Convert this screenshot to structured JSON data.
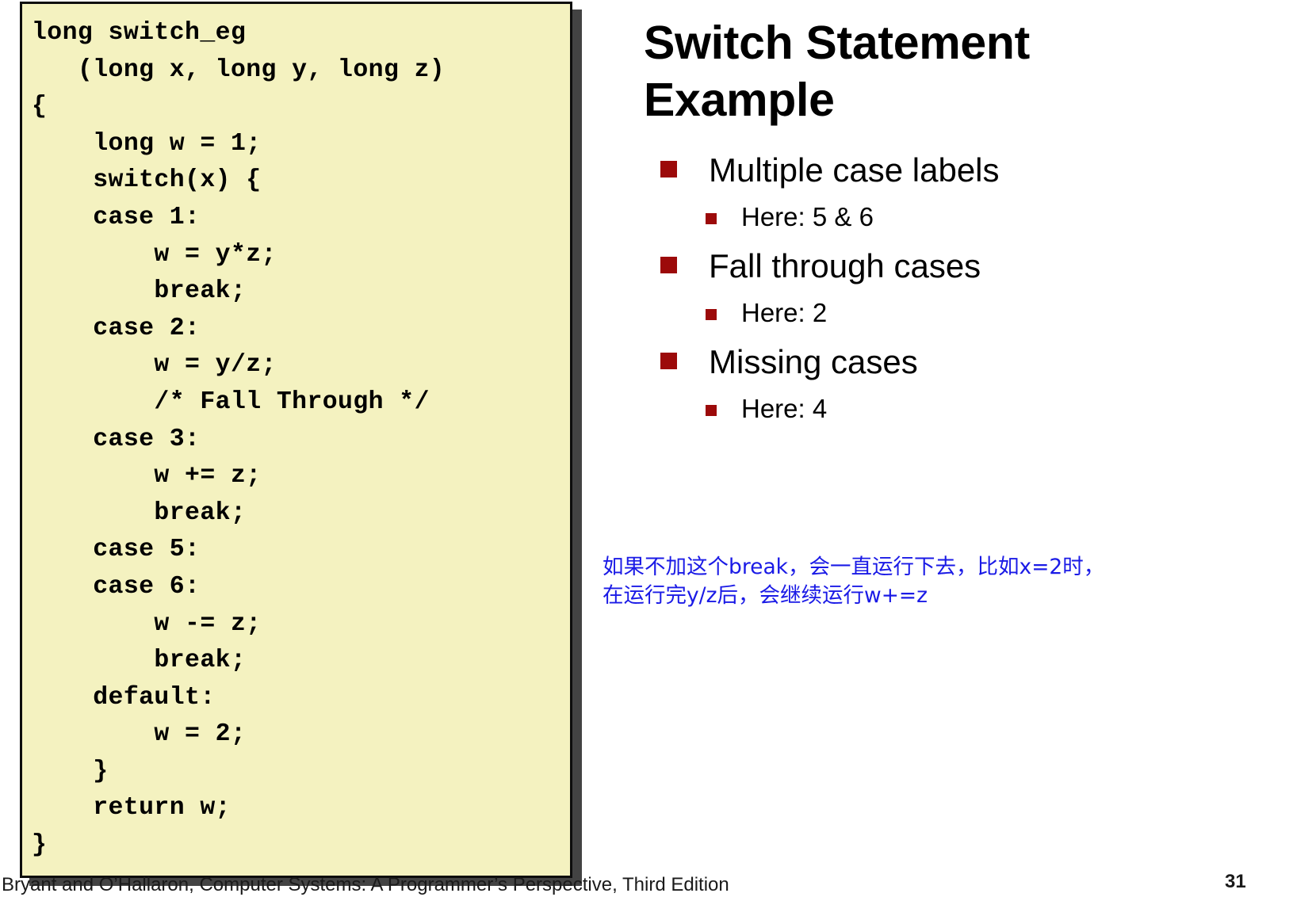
{
  "slide": {
    "title": "Switch Statement Example",
    "page_number": "31",
    "footer": "Bryant and O’Hallaron, Computer Systems: A Programmer’s Perspective, Third Edition",
    "accent_color": "#9c0a0a",
    "code_box_background": "#f4f2c0",
    "code_box_border": "#0d0d0d",
    "code_box_shadow": "#434343",
    "annotation_color": "#1a1ae6"
  },
  "code_block": {
    "language": "c",
    "text": "long switch_eg\n   (long x, long y, long z)\n{\n    long w = 1;\n    switch(x) {\n    case 1:\n        w = y*z;\n        break;\n    case 2:\n        w = y/z;\n        /* Fall Through */\n    case 3:\n        w += z;\n        break;\n    case 5:\n    case 6:\n        w -= z;\n        break;\n    default:\n        w = 2;\n    }\n    return w;\n}"
  },
  "bullets": [
    {
      "label": "Multiple case labels",
      "marker": "square-bullet-level1",
      "sub": [
        {
          "label": "Here: 5 & 6",
          "marker": "square-bullet-level2"
        }
      ]
    },
    {
      "label": "Fall through cases",
      "marker": "square-bullet-level1",
      "sub": [
        {
          "label": "Here: 2",
          "marker": "square-bullet-level2"
        }
      ]
    },
    {
      "label": "Missing cases",
      "marker": "square-bullet-level1",
      "sub": [
        {
          "label": "Here: 4",
          "marker": "square-bullet-level2"
        }
      ]
    }
  ],
  "annotation": {
    "line1": "如果不加这个break，会一直运行下去，比如x=2时，",
    "line2": "在运行完y/z后，会继续运行w+=z"
  }
}
